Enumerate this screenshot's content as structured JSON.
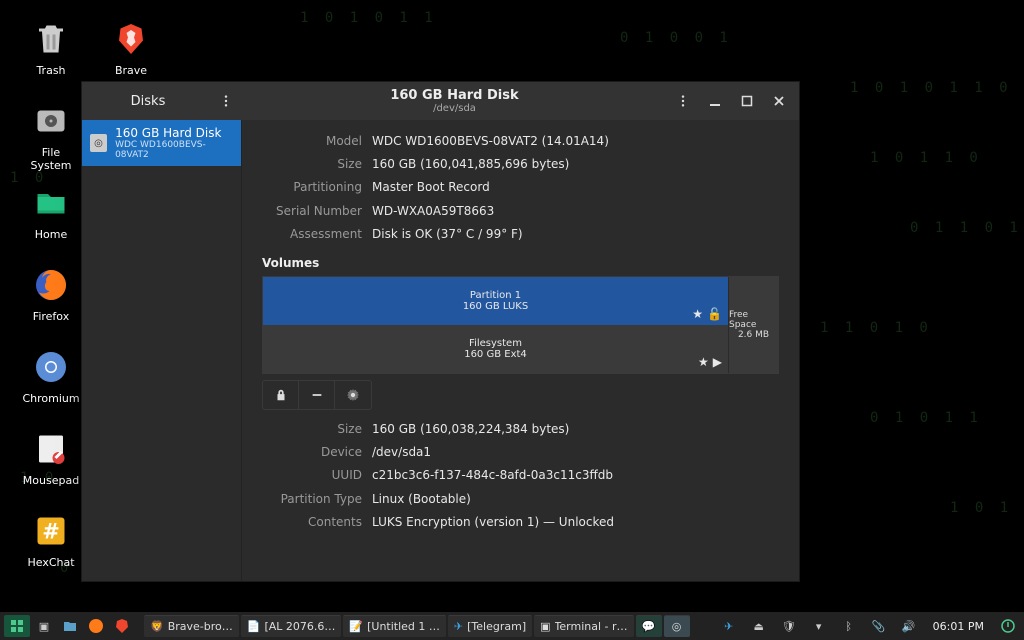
{
  "desktop_icons": [
    {
      "label": "Trash",
      "icon": "trash"
    },
    {
      "label": "Brave",
      "icon": "brave"
    },
    {
      "label": "File System",
      "icon": "disk"
    },
    {
      "label": "Home",
      "icon": "folder"
    },
    {
      "label": "Firefox",
      "icon": "firefox"
    },
    {
      "label": "Chromium",
      "icon": "chromium"
    },
    {
      "label": "Mousepad",
      "icon": "text"
    },
    {
      "label": "HexChat",
      "icon": "hexchat"
    }
  ],
  "window": {
    "app_label": "Disks",
    "title": "160 GB Hard Disk",
    "subtitle": "/dev/sda",
    "sidebar_item": {
      "title": "160 GB Hard Disk",
      "sub": "WDC WD1600BEVS-08VAT2"
    },
    "disk_info": [
      {
        "label": "Model",
        "value": "WDC WD1600BEVS-08VAT2 (14.01A14)"
      },
      {
        "label": "Size",
        "value": "160 GB (160,041,885,696 bytes)"
      },
      {
        "label": "Partitioning",
        "value": "Master Boot Record"
      },
      {
        "label": "Serial Number",
        "value": "WD-WXA0A59T8663"
      },
      {
        "label": "Assessment",
        "value": "Disk is OK (37° C / 99° F)"
      }
    ],
    "volumes_heading": "Volumes",
    "volume_partition": {
      "line1": "Partition 1",
      "line2": "160 GB LUKS"
    },
    "volume_fs": {
      "line1": "Filesystem",
      "line2": "160 GB Ext4"
    },
    "volume_free": {
      "line1": "Free Space",
      "line2": "2.6 MB"
    },
    "partition_info": [
      {
        "label": "Size",
        "value": "160 GB (160,038,224,384 bytes)"
      },
      {
        "label": "Device",
        "value": "/dev/sda1"
      },
      {
        "label": "UUID",
        "value": "c21bc3c6-f137-484c-8afd-0a3c11c3ffdb"
      },
      {
        "label": "Partition Type",
        "value": "Linux (Bootable)"
      },
      {
        "label": "Contents",
        "value": "LUKS Encryption (version 1) — Unlocked"
      }
    ]
  },
  "taskbar": {
    "items": [
      {
        "label": "Brave-bro…"
      },
      {
        "label": "[AL 2076.6…"
      },
      {
        "label": "[Untitled 1 …"
      },
      {
        "label": "[Telegram]"
      },
      {
        "label": "Terminal - r…"
      }
    ],
    "time": "06:01 PM"
  },
  "colors": {
    "selection": "#1d6fc0",
    "window_bg": "#2b2b2b",
    "titlebar": "#333333"
  }
}
